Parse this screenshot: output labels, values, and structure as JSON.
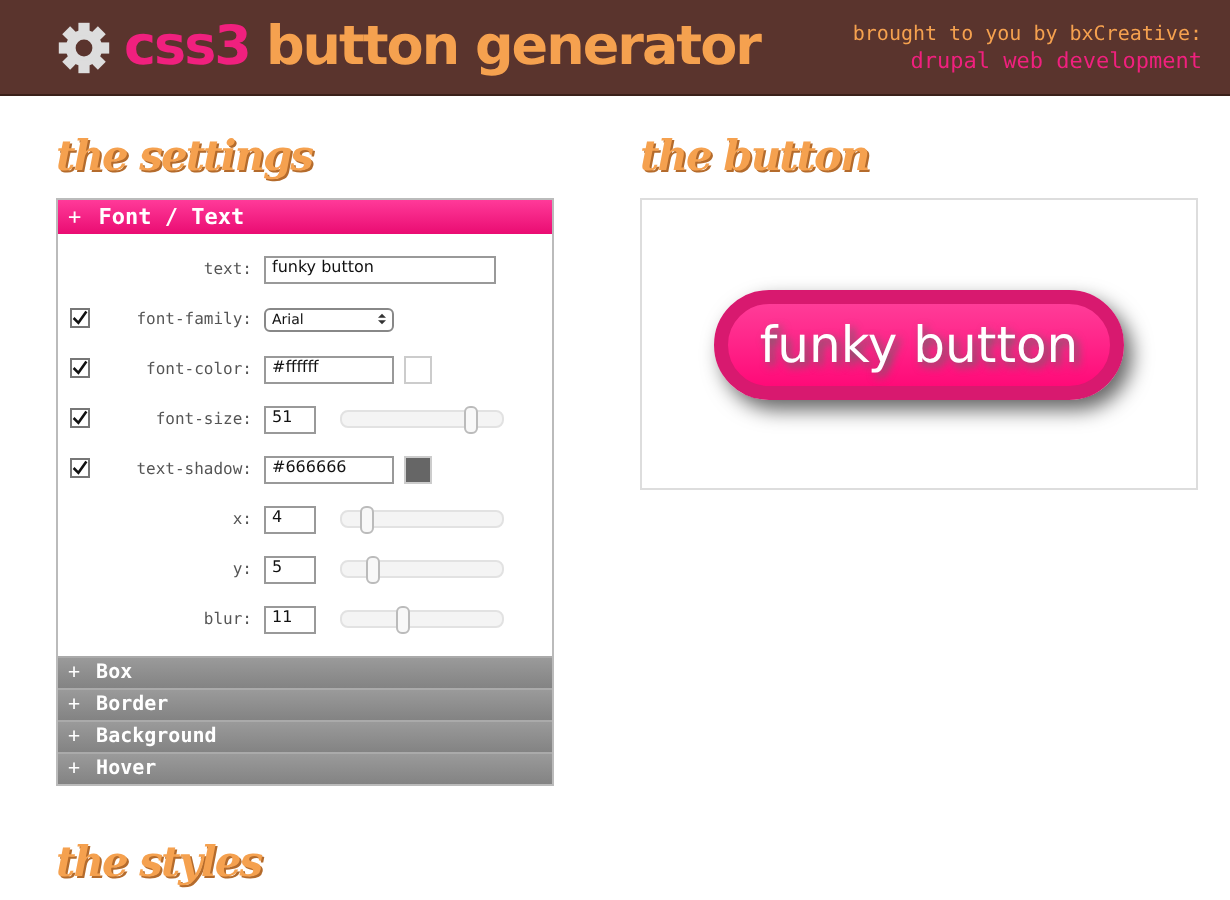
{
  "header": {
    "logo_accent": "css3",
    "logo_title": "button generator",
    "credit": "brought to you by bxCreative:",
    "credit_link": "drupal web development"
  },
  "settings": {
    "heading": "the settings",
    "open_section": {
      "icon": "+",
      "title": "Font / Text"
    },
    "rows": [
      {
        "kind": "text",
        "label": "text:",
        "value": "funky button"
      },
      {
        "kind": "select",
        "label": "font-family:",
        "value": "Arial",
        "checked": true
      },
      {
        "kind": "color",
        "label": "font-color:",
        "value": "#ffffff",
        "color": "#ffffff",
        "checked": true
      },
      {
        "kind": "slider",
        "label": "font-size:",
        "value": "51",
        "level": 0.85,
        "checked": true
      },
      {
        "kind": "color",
        "label": "text-shadow:",
        "value": "#666666",
        "color": "#666666",
        "checked": true
      },
      {
        "kind": "slider",
        "label": "x:",
        "value": "4",
        "level": 0.12
      },
      {
        "kind": "slider",
        "label": "y:",
        "value": "5",
        "level": 0.17
      },
      {
        "kind": "slider",
        "label": "blur:",
        "value": "11",
        "level": 0.38
      }
    ],
    "sections": [
      {
        "icon": "+",
        "title": "Box"
      },
      {
        "icon": "+",
        "title": "Border"
      },
      {
        "icon": "+",
        "title": "Background"
      },
      {
        "icon": "+",
        "title": "Hover"
      }
    ]
  },
  "preview": {
    "heading": "the button",
    "button_label": "funky button"
  },
  "styles": {
    "heading": "the styles"
  }
}
